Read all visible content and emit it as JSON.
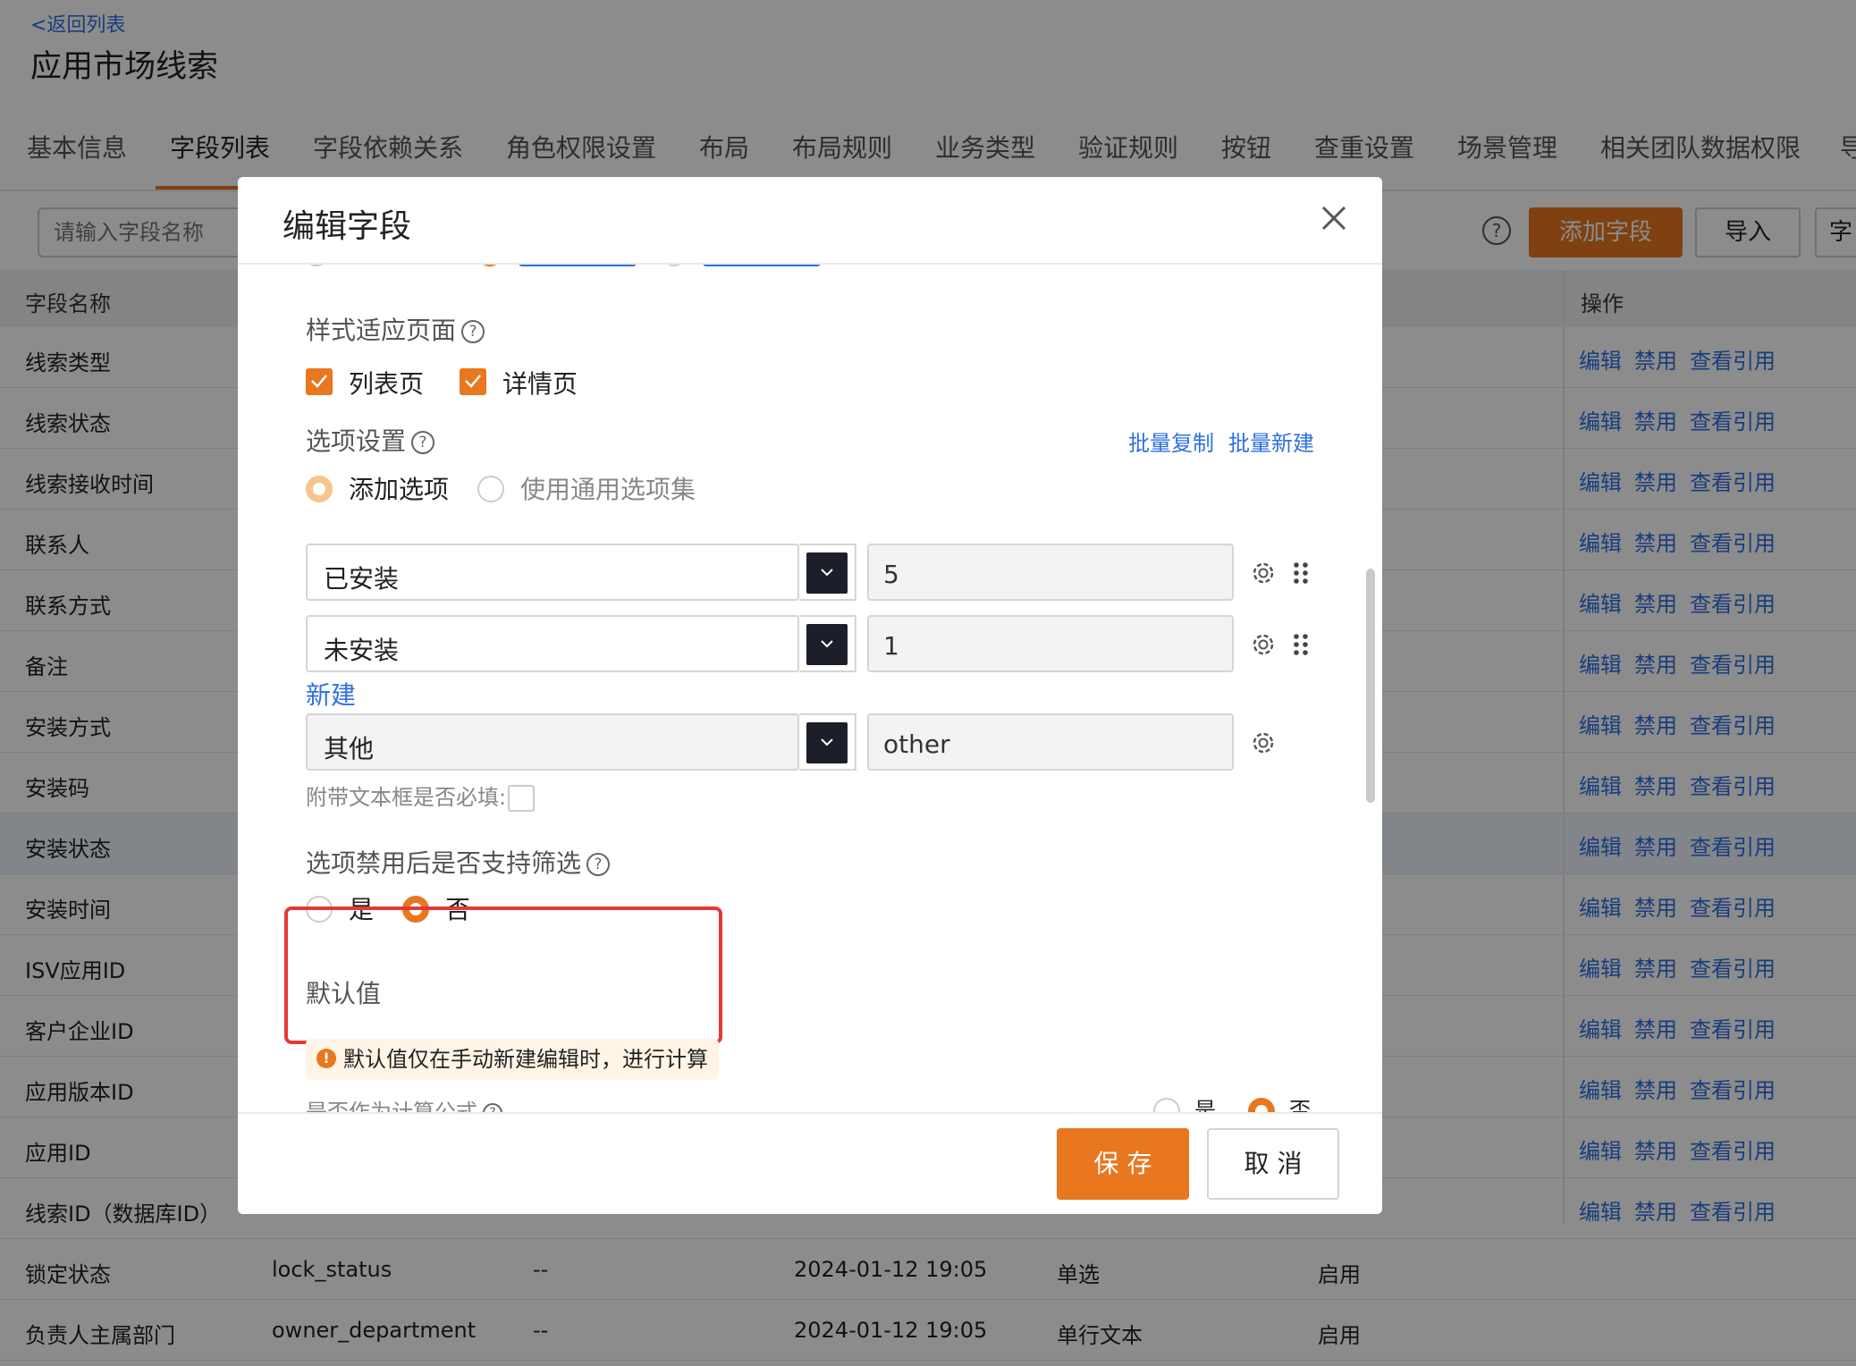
{
  "back_link": "<返回列表",
  "app_title": "应用市场线索",
  "tabs": [
    "基本信息",
    "字段列表",
    "字段依赖关系",
    "角色权限设置",
    "布局",
    "布局规则",
    "业务类型",
    "验证规则",
    "按钮",
    "查重设置",
    "场景管理",
    "相关团队数据权限",
    "导"
  ],
  "toolbar": {
    "search_placeholder": "请输入字段名称",
    "help": "?",
    "add_field": "添加字段",
    "import": "导入",
    "more": "字"
  },
  "table": {
    "headers": {
      "name": "字段名称",
      "ops": "操作"
    },
    "ops": [
      "编辑",
      "禁用",
      "查看引用"
    ],
    "rows": [
      {
        "name": "线索类型"
      },
      {
        "name": "线索状态"
      },
      {
        "name": "线索接收时间"
      },
      {
        "name": "联系人"
      },
      {
        "name": "联系方式"
      },
      {
        "name": "备注"
      },
      {
        "name": "安装方式"
      },
      {
        "name": "安装码"
      },
      {
        "name": "安装状态"
      },
      {
        "name": "安装时间"
      },
      {
        "name": "ISV应用ID"
      },
      {
        "name": "客户企业ID"
      },
      {
        "name": "应用版本ID"
      },
      {
        "name": "应用ID"
      },
      {
        "name": "线索ID（数据库ID）"
      },
      {
        "name": "锁定状态",
        "key": "lock_status",
        "desc": "--",
        "time": "2024-01-12 19:05",
        "type": "单选",
        "status": "启用"
      },
      {
        "name": "负责人主属部门",
        "key": "owner_department",
        "desc": "--",
        "time": "2024-01-12 19:05",
        "type": "单行文本",
        "status": "启用"
      }
    ]
  },
  "modal": {
    "title": "编辑字段",
    "style_pages": {
      "label": "样式适应页面",
      "options": [
        "列表页",
        "详情页"
      ]
    },
    "options_setting": {
      "label": "选项设置",
      "batch_copy": "批量复制",
      "batch_create": "批量新建",
      "mode_add": "添加选项",
      "mode_common": "使用通用选项集",
      "items": [
        {
          "name": "已安装",
          "value": "5"
        },
        {
          "name": "未安装",
          "value": "1"
        }
      ],
      "new_link": "新建",
      "other": {
        "name": "其他",
        "value": "other"
      },
      "attach_required": "附带文本框是否必填:"
    },
    "disabled_filter": {
      "label": "选项禁用后是否支持筛选",
      "yes": "是",
      "no": "否"
    },
    "default_value": {
      "label": "默认值",
      "notice": "默认值仅在手动新建编辑时，进行计算",
      "formula_label": "是否作为计算公式",
      "yes": "是",
      "no": "否"
    },
    "save": "保 存",
    "cancel": "取 消"
  },
  "colors": {
    "accent": "#e8771f",
    "link": "#2f6fe0",
    "highlight": "#e53935"
  }
}
